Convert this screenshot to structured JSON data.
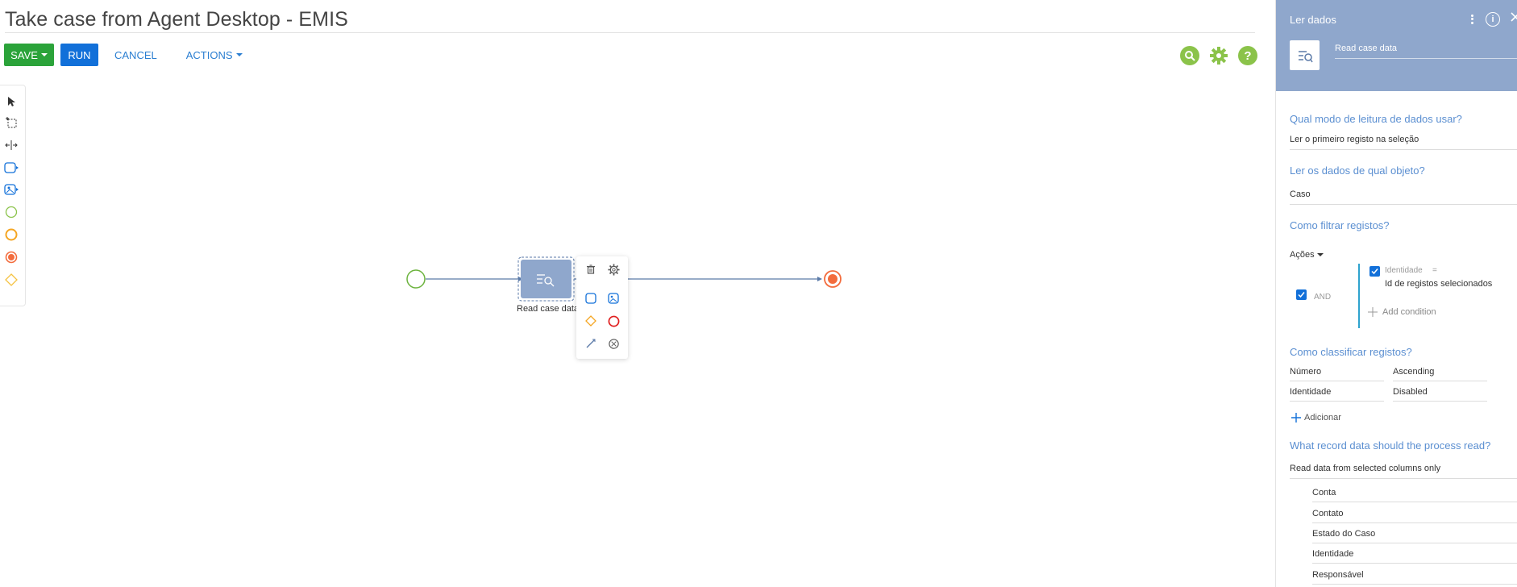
{
  "window": {
    "title": "Take case from Agent Desktop - EMIS"
  },
  "toolbar": {
    "save_label": "SAVE",
    "run_label": "RUN",
    "cancel_label": "CANCEL",
    "actions_label": "ACTIONS"
  },
  "top_icons": [
    "search-icon",
    "gear-icon",
    "help-icon"
  ],
  "palette": {
    "items": [
      "pointer-tool",
      "lasso-select-tool",
      "space-tool",
      "task-element",
      "user-task-element",
      "start-event",
      "intermediate-event",
      "end-event",
      "gateway"
    ]
  },
  "canvas": {
    "task_label": "Read case data",
    "colors": {
      "start": "#6cb33e",
      "end": "#f36c3d",
      "task": "#8fa7cc",
      "flow": "#5b7aa8"
    }
  },
  "panel": {
    "header_title": "Ler dados",
    "element_name": "Read case data",
    "q_read_mode": "Qual modo de leitura de dados usar?",
    "read_mode_value": "Ler o primeiro registo na seleção",
    "q_object": "Ler os dados de qual objeto?",
    "object_value": "Caso",
    "q_filter": "Como filtrar registos?",
    "acoes_label": "Ações",
    "filter": {
      "operator": "AND",
      "condition_field": "Identidade",
      "condition_operator": "=",
      "condition_value": "Id de registos selecionados",
      "add_condition_label": "Add condition"
    },
    "q_sort": "Como classificar registos?",
    "sort": [
      {
        "column": "Número",
        "direction": "Ascending"
      },
      {
        "column": "Identidade",
        "direction": "Disabled"
      }
    ],
    "adicionar_label": "Adicionar",
    "q_record_data": "What record data should the process read?",
    "record_data_value": "Read data from selected columns only",
    "columns": [
      "Conta",
      "Contato",
      "Estado do Caso",
      "Identidade",
      "Responsável"
    ]
  }
}
